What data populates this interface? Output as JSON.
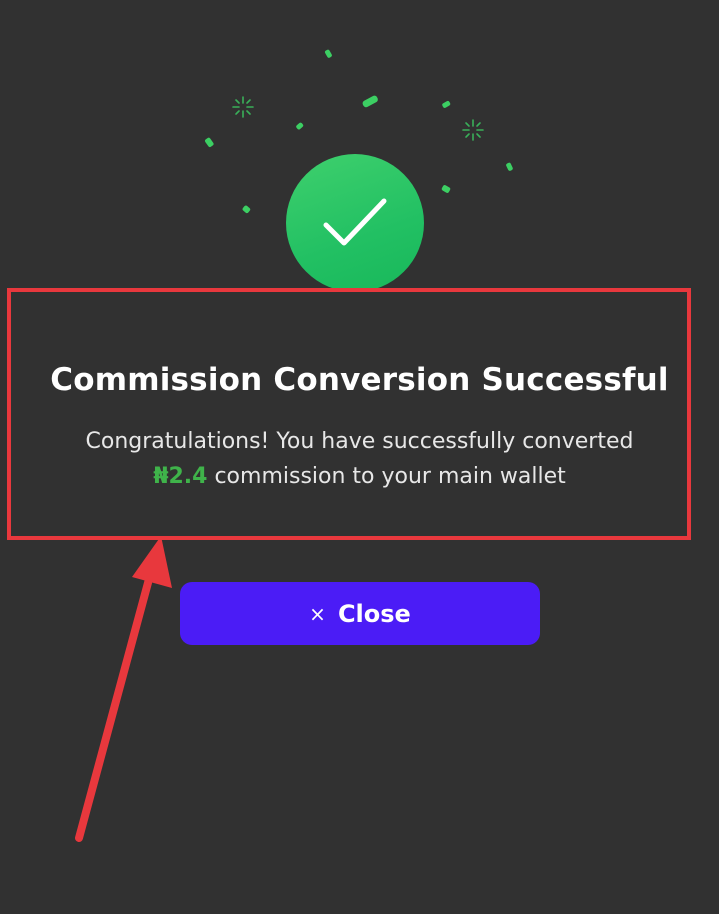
{
  "dialog": {
    "title": "Commission Conversion Successful",
    "message_prefix": "Congratulations! You have successfully converted",
    "amount": "₦2.4",
    "message_suffix": " commission to your main wallet",
    "close_icon": "×",
    "close_label": "Close"
  },
  "icons": {
    "success": "check-icon",
    "confetti": "confetti-icon",
    "sparkle": "sparkle-icon"
  },
  "colors": {
    "background": "#313131",
    "success_green": "#22c063",
    "amount_green": "#3fb34a",
    "button": "#4b1cf6",
    "annotation_red": "#e8383d"
  }
}
